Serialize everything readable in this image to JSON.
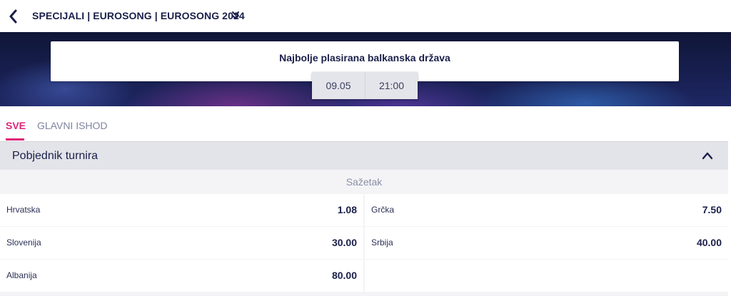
{
  "header": {
    "breadcrumb": "SPECIJALI | EUROSONG | EUROSONG 2024",
    "back_icon": "chevron-left-icon",
    "expand_icon": "double-chevron-down-icon"
  },
  "event": {
    "title": "Najbolje plasirana balkanska država",
    "date": "09.05",
    "time": "21:00"
  },
  "tabs": [
    {
      "label": "SVE",
      "active": true
    },
    {
      "label": "GLAVNI ISHOD",
      "active": false
    }
  ],
  "market": {
    "title": "Pobjednik turnira",
    "collapse_icon": "chevron-up-icon",
    "summary_label": "Sažetak",
    "selections": [
      {
        "name": "Hrvatska",
        "odds": "1.08"
      },
      {
        "name": "Grčka",
        "odds": "7.50"
      },
      {
        "name": "Slovenija",
        "odds": "30.00"
      },
      {
        "name": "Srbija",
        "odds": "40.00"
      },
      {
        "name": "Albanija",
        "odds": "80.00"
      }
    ]
  },
  "colors": {
    "accent": "#e0237a",
    "text_primary": "#1a1f4a",
    "hero_dark": "#101637"
  }
}
